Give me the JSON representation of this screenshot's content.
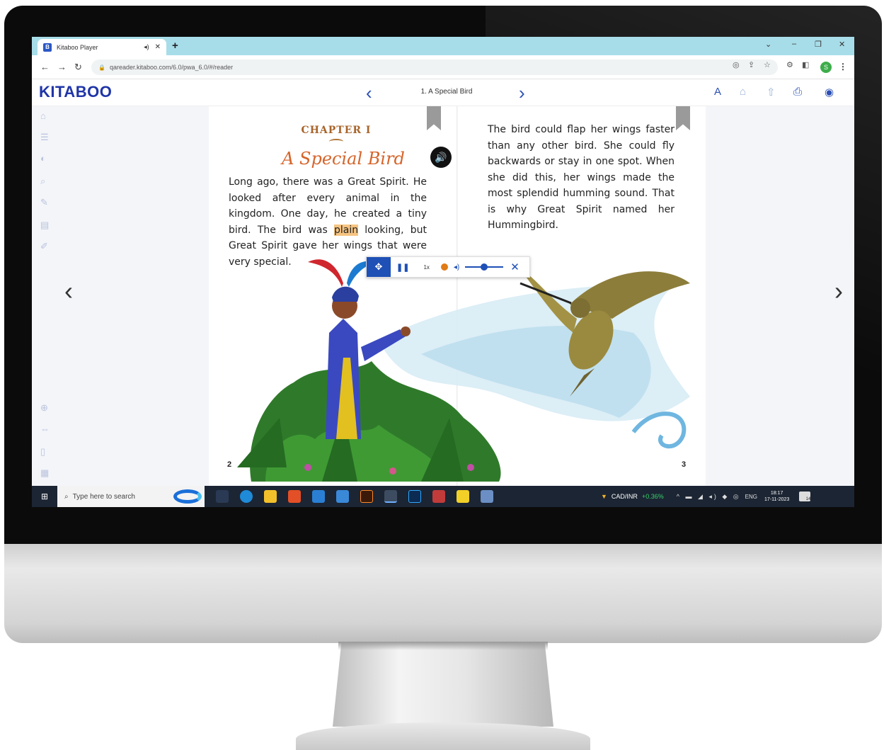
{
  "browser": {
    "tab_title": "Kitaboo Player",
    "tab_favicon": "B",
    "new_tab": "+",
    "url": "qareader.kitaboo.com/6.0/pwa_6.0/#/reader",
    "profile_initial": "S",
    "window_controls": [
      "⌄",
      "–",
      "❐",
      "✕"
    ]
  },
  "reader_header": {
    "logo": "KITABOO",
    "chapter": "1. A Special Bird"
  },
  "book": {
    "chapter_label": "CHAPTER I",
    "chapter_title": "A Special Bird",
    "left_text_before": "Long ago, there was a Great Spirit. He looked after every animal in the kingdom. One day, he created a tiny bird. The bird was ",
    "left_text_highlight": "plain",
    "left_text_after": " looking, but Great Spirit gave her wings that were very special.",
    "right_text": "The bird could flap her wings faster than any other bird. She could fly backwards or stay in one spot. When she did this, her wings made the most splendid humming sound. That is why Great Spirit named her Hummingbird.",
    "left_page_number": "2",
    "right_page_number": "3",
    "highlight_color": "#f6c482"
  },
  "audio_player": {
    "speed": "1x",
    "volume_level": 0.5
  },
  "taskbar": {
    "search_placeholder": "Type here to search",
    "ticker": "CAD/INR",
    "ticker_change": "+0.36%",
    "language": "ENG",
    "time": "18:17",
    "date": "17-11-2023",
    "notification_count": "14"
  },
  "colors": {
    "brand": "#1f35a8",
    "accent": "#2b4fb4",
    "tab_bar": "#a7dde8",
    "chapter_title": "#d5642a"
  }
}
